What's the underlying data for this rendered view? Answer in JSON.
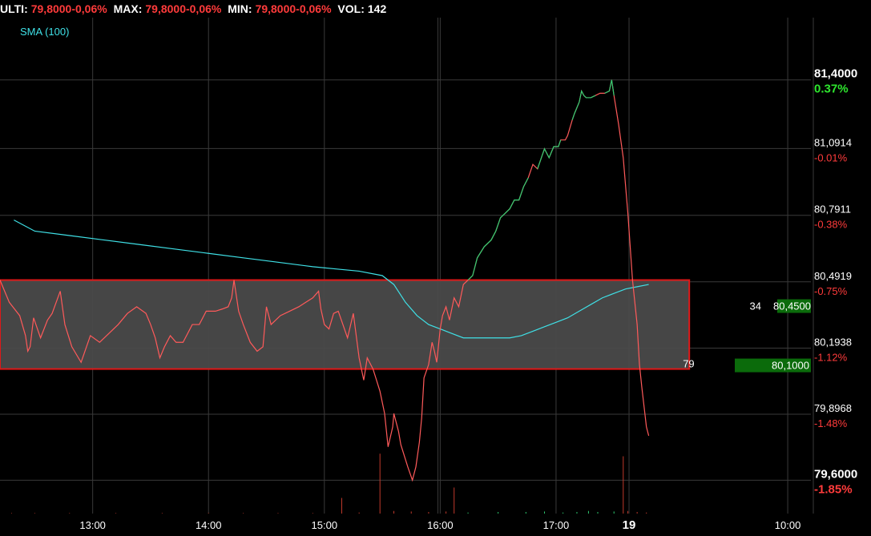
{
  "header": {
    "ulti_label": "ULTI:",
    "ulti_value": "79,8000-0,06%",
    "max_label": "MAX:",
    "max_value": "79,8000-0,06%",
    "min_label": "MIN:",
    "min_value": "79,8000-0,06%",
    "vol_label": "VOL:",
    "vol_value": "142"
  },
  "legend": {
    "sma_label": "SMA (100)"
  },
  "colors": {
    "price": "#ff5a5a",
    "price_up": "#2ecc71",
    "sma": "#3fe0e6",
    "grid": "#3a3a3a",
    "box_border": "#e01818",
    "box_fill": "#4a4a4a",
    "last_price_bg": "#0b6b0b"
  },
  "chart_data": {
    "type": "line",
    "ylim": [
      79.45,
      81.68
    ],
    "y_ticks": [
      {
        "value": 81.4,
        "label": "81,4000",
        "pct": "0.37%",
        "bold": true,
        "pct_color": "#2ee62e"
      },
      {
        "value": 81.0914,
        "label": "81,0914",
        "pct": "-0.01%",
        "bold": false,
        "pct_color": "#ff3b3b"
      },
      {
        "value": 80.7911,
        "label": "80,7911",
        "pct": "-0.38%",
        "bold": false,
        "pct_color": "#ff3b3b"
      },
      {
        "value": 80.4919,
        "label": "80,4919",
        "pct": "-0.75%",
        "bold": false,
        "pct_color": "#ff3b3b"
      },
      {
        "value": 80.1938,
        "label": "80,1938",
        "pct": "-1.12%",
        "bold": false,
        "pct_color": "#ff3b3b"
      },
      {
        "value": 79.8968,
        "label": "79,8968",
        "pct": "-1.48%",
        "bold": false,
        "pct_color": "#ff3b3b"
      },
      {
        "value": 79.6,
        "label": "79,6000",
        "pct": "-1.85%",
        "bold": true,
        "pct_color": "#ff3b3b"
      }
    ],
    "x_ticks": [
      {
        "t": 13.0,
        "label": "13:00",
        "bold": false
      },
      {
        "t": 14.0,
        "label": "14:00",
        "bold": false
      },
      {
        "t": 15.0,
        "label": "15:00",
        "bold": false
      },
      {
        "t": 16.0,
        "label": "16:00",
        "bold": false
      },
      {
        "t": 17.0,
        "label": "17:00",
        "bold": false
      },
      {
        "t": 17.63,
        "label": "19",
        "bold": true
      },
      {
        "t": 19.0,
        "label": "10:00",
        "bold": false
      }
    ],
    "t_range": [
      12.2,
      19.2
    ],
    "extra_vlines": [
      15.98
    ],
    "price_box": {
      "top": 80.5,
      "bottom": 80.1,
      "t_start": 12.2,
      "t_end": 18.15,
      "left_label": "79",
      "right_label": "80,1000",
      "upper_left_label": "34",
      "upper_right_label": "80,4500"
    },
    "price_series": [
      [
        12.2,
        80.5
      ],
      [
        12.28,
        80.4
      ],
      [
        12.37,
        80.34
      ],
      [
        12.42,
        80.25
      ],
      [
        12.44,
        80.18
      ],
      [
        12.46,
        80.2
      ],
      [
        12.49,
        80.33
      ],
      [
        12.55,
        80.24
      ],
      [
        12.61,
        80.32
      ],
      [
        12.65,
        80.35
      ],
      [
        12.72,
        80.45
      ],
      [
        12.76,
        80.3
      ],
      [
        12.82,
        80.2
      ],
      [
        12.9,
        80.13
      ],
      [
        12.98,
        80.25
      ],
      [
        13.06,
        80.22
      ],
      [
        13.14,
        80.26
      ],
      [
        13.22,
        80.3
      ],
      [
        13.3,
        80.35
      ],
      [
        13.38,
        80.38
      ],
      [
        13.46,
        80.35
      ],
      [
        13.5,
        80.3
      ],
      [
        13.54,
        80.24
      ],
      [
        13.58,
        80.15
      ],
      [
        13.62,
        80.2
      ],
      [
        13.67,
        80.25
      ],
      [
        13.72,
        80.22
      ],
      [
        13.78,
        80.22
      ],
      [
        13.86,
        80.3
      ],
      [
        13.92,
        80.3
      ],
      [
        13.98,
        80.36
      ],
      [
        14.06,
        80.36
      ],
      [
        14.12,
        80.37
      ],
      [
        14.17,
        80.38
      ],
      [
        14.2,
        80.42
      ],
      [
        14.22,
        80.5
      ],
      [
        14.26,
        80.36
      ],
      [
        14.3,
        80.3
      ],
      [
        14.36,
        80.22
      ],
      [
        14.42,
        80.18
      ],
      [
        14.47,
        80.2
      ],
      [
        14.5,
        80.38
      ],
      [
        14.54,
        80.3
      ],
      [
        14.62,
        80.34
      ],
      [
        14.7,
        80.36
      ],
      [
        14.78,
        80.38
      ],
      [
        14.84,
        80.4
      ],
      [
        14.9,
        80.42
      ],
      [
        14.95,
        80.45
      ],
      [
        14.97,
        80.37
      ],
      [
        15.0,
        80.3
      ],
      [
        15.04,
        80.28
      ],
      [
        15.08,
        80.35
      ],
      [
        15.12,
        80.36
      ],
      [
        15.16,
        80.3
      ],
      [
        15.2,
        80.24
      ],
      [
        15.25,
        80.35
      ],
      [
        15.3,
        80.15
      ],
      [
        15.34,
        80.05
      ],
      [
        15.37,
        80.15
      ],
      [
        15.42,
        80.1
      ],
      [
        15.48,
        80.0
      ],
      [
        15.52,
        79.9
      ],
      [
        15.55,
        79.75
      ],
      [
        15.59,
        79.84
      ],
      [
        15.6,
        79.9
      ],
      [
        15.64,
        79.82
      ],
      [
        15.66,
        79.76
      ],
      [
        15.72,
        79.66
      ],
      [
        15.76,
        79.6
      ],
      [
        15.79,
        79.66
      ],
      [
        15.82,
        79.77
      ],
      [
        15.84,
        79.88
      ],
      [
        15.86,
        80.06
      ],
      [
        15.9,
        80.12
      ],
      [
        15.93,
        80.22
      ],
      [
        15.95,
        80.18
      ],
      [
        15.97,
        80.13
      ],
      [
        16.0,
        80.28
      ],
      [
        16.02,
        80.34
      ],
      [
        16.05,
        80.38
      ],
      [
        16.08,
        80.32
      ],
      [
        16.12,
        80.42
      ],
      [
        16.16,
        80.38
      ],
      [
        16.2,
        80.48
      ],
      [
        16.24,
        80.5
      ],
      [
        16.28,
        80.52
      ],
      [
        16.32,
        80.6
      ],
      [
        16.38,
        80.65
      ],
      [
        16.44,
        80.68
      ],
      [
        16.48,
        80.72
      ],
      [
        16.52,
        80.78
      ],
      [
        16.56,
        80.8
      ],
      [
        16.6,
        80.82
      ],
      [
        16.64,
        80.86
      ],
      [
        16.68,
        80.86
      ],
      [
        16.72,
        80.92
      ],
      [
        16.76,
        80.96
      ],
      [
        16.8,
        81.02
      ],
      [
        16.84,
        81.0
      ],
      [
        16.88,
        81.06
      ],
      [
        16.9,
        81.09
      ],
      [
        16.94,
        81.05
      ],
      [
        16.98,
        81.1
      ],
      [
        17.02,
        81.1
      ],
      [
        17.04,
        81.13
      ],
      [
        17.08,
        81.13
      ],
      [
        17.1,
        81.15
      ],
      [
        17.14,
        81.22
      ],
      [
        17.16,
        81.25
      ],
      [
        17.2,
        81.3
      ],
      [
        17.22,
        81.35
      ],
      [
        17.24,
        81.33
      ],
      [
        17.26,
        81.32
      ],
      [
        17.3,
        81.32
      ],
      [
        17.34,
        81.33
      ],
      [
        17.38,
        81.34
      ],
      [
        17.42,
        81.34
      ],
      [
        17.46,
        81.35
      ],
      [
        17.48,
        81.4
      ],
      [
        17.5,
        81.33
      ],
      [
        17.54,
        81.2
      ],
      [
        17.58,
        81.05
      ],
      [
        17.62,
        80.8
      ],
      [
        17.66,
        80.5
      ],
      [
        17.7,
        80.3
      ],
      [
        17.72,
        80.12
      ],
      [
        17.74,
        80.02
      ],
      [
        17.76,
        79.93
      ],
      [
        17.78,
        79.84
      ],
      [
        17.8,
        79.8
      ]
    ],
    "price_up_segments": [
      [
        16.22,
        16.78
      ],
      [
        16.84,
        17.06
      ],
      [
        17.14,
        17.36
      ],
      [
        17.4,
        17.52
      ]
    ],
    "sma_series": [
      [
        12.32,
        80.77
      ],
      [
        12.5,
        80.72
      ],
      [
        12.8,
        80.7
      ],
      [
        13.1,
        80.68
      ],
      [
        13.4,
        80.66
      ],
      [
        13.7,
        80.64
      ],
      [
        14.0,
        80.62
      ],
      [
        14.3,
        80.6
      ],
      [
        14.6,
        80.58
      ],
      [
        14.9,
        80.56
      ],
      [
        15.1,
        80.55
      ],
      [
        15.3,
        80.54
      ],
      [
        15.5,
        80.52
      ],
      [
        15.6,
        80.48
      ],
      [
        15.7,
        80.4
      ],
      [
        15.8,
        80.34
      ],
      [
        15.9,
        80.3
      ],
      [
        16.0,
        80.28
      ],
      [
        16.1,
        80.26
      ],
      [
        16.2,
        80.24
      ],
      [
        16.3,
        80.24
      ],
      [
        16.4,
        80.24
      ],
      [
        16.5,
        80.24
      ],
      [
        16.6,
        80.24
      ],
      [
        16.7,
        80.25
      ],
      [
        16.8,
        80.27
      ],
      [
        16.9,
        80.29
      ],
      [
        17.0,
        80.31
      ],
      [
        17.1,
        80.33
      ],
      [
        17.2,
        80.36
      ],
      [
        17.3,
        80.39
      ],
      [
        17.4,
        80.42
      ],
      [
        17.5,
        80.44
      ],
      [
        17.6,
        80.46
      ],
      [
        17.7,
        80.47
      ],
      [
        17.8,
        80.48
      ]
    ],
    "volume_bars": [
      [
        12.3,
        1
      ],
      [
        12.5,
        1
      ],
      [
        12.8,
        1
      ],
      [
        13.2,
        1
      ],
      [
        13.6,
        1
      ],
      [
        14.0,
        1
      ],
      [
        14.3,
        1
      ],
      [
        14.6,
        1
      ],
      [
        14.9,
        1
      ],
      [
        15.15,
        30
      ],
      [
        15.3,
        2
      ],
      [
        15.48,
        115
      ],
      [
        15.6,
        5
      ],
      [
        15.75,
        4
      ],
      [
        15.9,
        3
      ],
      [
        16.05,
        4
      ],
      [
        16.12,
        50
      ],
      [
        16.24,
        2
      ],
      [
        16.5,
        3
      ],
      [
        16.74,
        3
      ],
      [
        16.9,
        4
      ],
      [
        17.06,
        2
      ],
      [
        17.18,
        3
      ],
      [
        17.28,
        5
      ],
      [
        17.36,
        3
      ],
      [
        17.5,
        4
      ],
      [
        17.58,
        110
      ],
      [
        17.62,
        5
      ],
      [
        17.7,
        3
      ],
      [
        17.78,
        2
      ]
    ]
  }
}
